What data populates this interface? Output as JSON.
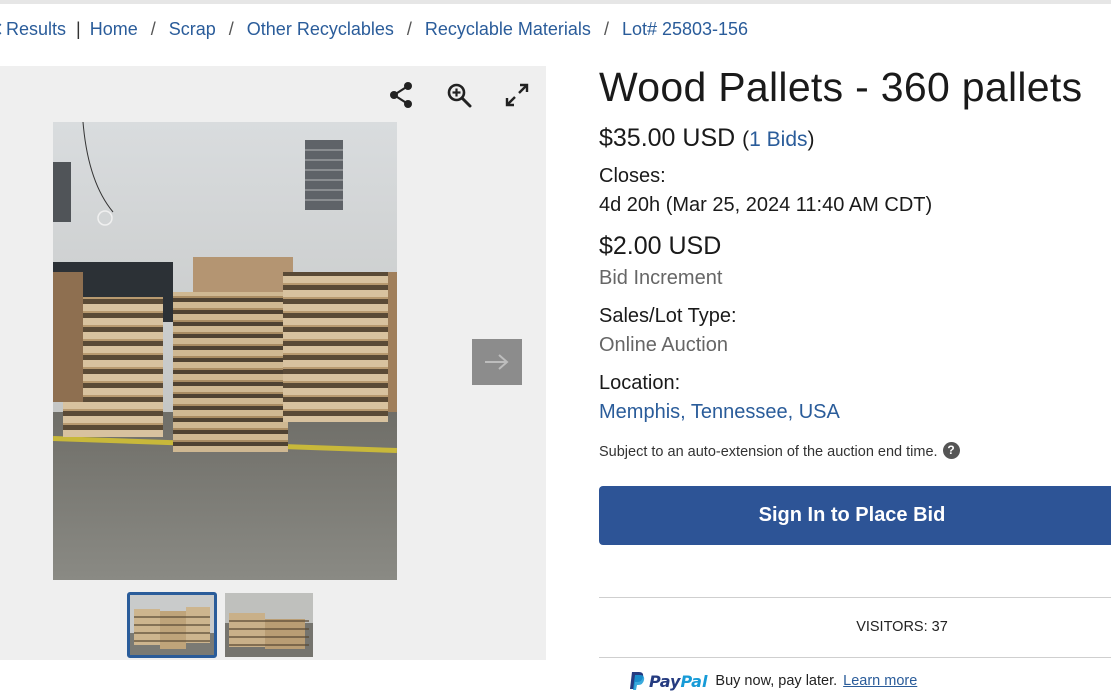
{
  "breadcrumb": {
    "back_label": "Results",
    "items": [
      {
        "label": "Home"
      },
      {
        "label": "Scrap"
      },
      {
        "label": "Other Recyclables"
      },
      {
        "label": "Recyclable Materials"
      },
      {
        "label": "Lot# 25803-156"
      }
    ]
  },
  "gallery": {
    "tools": [
      "share-icon",
      "zoom-in-icon",
      "fullscreen-icon"
    ],
    "thumbnail_count": 2,
    "active_thumbnail": 1
  },
  "listing": {
    "title": "Wood Pallets - 360 pallets",
    "price": "$35.00 USD",
    "bids_open": "(",
    "bids_count": "1 Bids",
    "bids_close": ")",
    "closes_label": "Closes:",
    "closes_value": "4d 20h (Mar 25, 2024 11:40 AM CDT)",
    "increment_value": "$2.00 USD",
    "increment_label": "Bid Increment",
    "type_label": "Sales/Lot Type:",
    "type_value": "Online Auction",
    "location_label": "Location:",
    "location_value": "Memphis, Tennessee, USA",
    "extension_note": "Subject to an auto-extension of the auction end time.",
    "help_glyph": "?",
    "bid_button": "Sign In to Place Bid",
    "visitors": "VISITORS: 37"
  },
  "paypal": {
    "logo_a": "Pay",
    "logo_b": "Pal",
    "text": "Buy now, pay later.",
    "learn_more": "Learn more"
  },
  "colors": {
    "link": "#2a5c9a",
    "button": "#2d5496",
    "gallery_bg": "#efefef",
    "arrow_bg": "#8c8c8c"
  }
}
